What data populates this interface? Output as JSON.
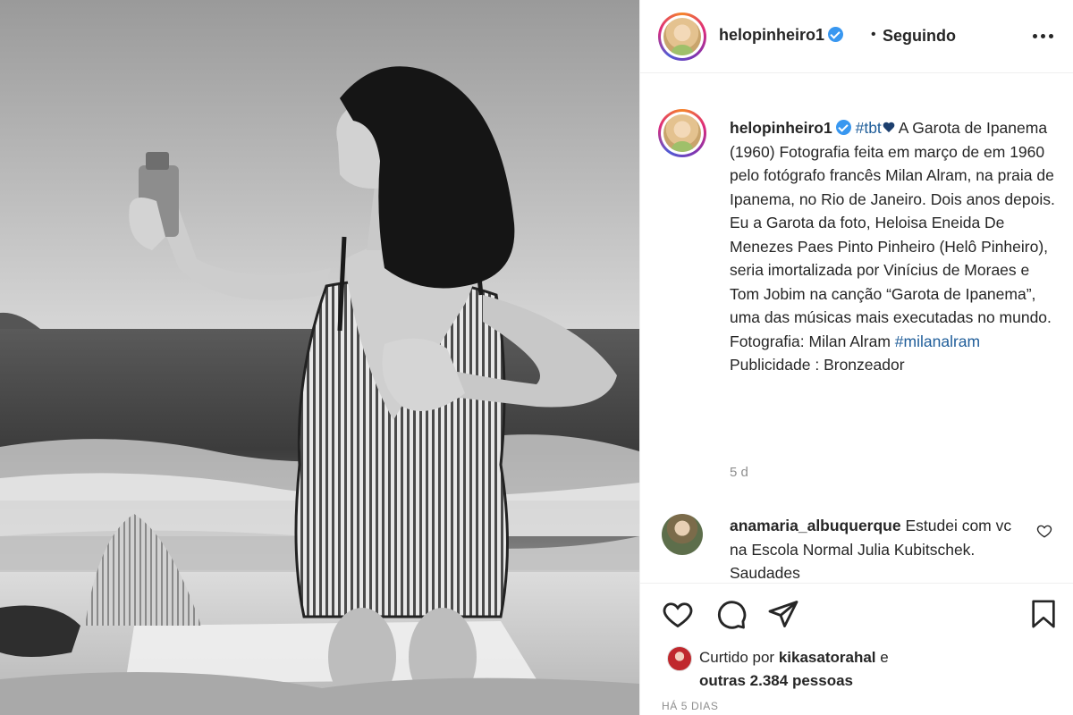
{
  "post": {
    "username": "helopinheiro1",
    "follow_status": "Seguindo",
    "dot": "•",
    "photo_alt": "Foto em preto e branco de mulher de maiô listrado ajoelhada na areia da praia segurando um frasco"
  },
  "caption": {
    "username": "helopinheiro1",
    "hashtag": "#tbt",
    "text": " A Garota de Ipanema (1960) Fotografia feita em março de em 1960 pelo fotógrafo francês Milan Alram, na praia de Ipanema, no Rio de Janeiro. Dois anos depois. Eu a Garota da foto, Heloisa Eneida De Menezes Paes Pinto Pinheiro (Helô Pinheiro), seria imortalizada por Vinícius de Moraes e Tom Jobim na canção “Garota de Ipanema”, uma das músicas mais executadas no mundo. Fotografia: Milan Alram ",
    "hashtag2": "#milanalram",
    "publicidade": "Publicidade : Bronzeador",
    "time": "5 d"
  },
  "comment": {
    "username": "anamaria_albuquerque",
    "text": " Estudei com vc na Escola Normal Julia Kubitschek. Saudades"
  },
  "likes": {
    "prefix": "Curtido por ",
    "user": "kikasatorahal",
    "suffix": " e",
    "others": "outras 2.384 pessoas"
  },
  "date": "HÁ 5 DIAS",
  "icons": {
    "more": "more-options-icon",
    "like": "heart-icon",
    "comment": "comment-icon",
    "share": "share-icon",
    "save": "bookmark-icon"
  },
  "colors": {
    "verified": "#3897f0",
    "hashtag": "#1f5d99",
    "muted": "#8e8e8e",
    "text": "#262626"
  }
}
